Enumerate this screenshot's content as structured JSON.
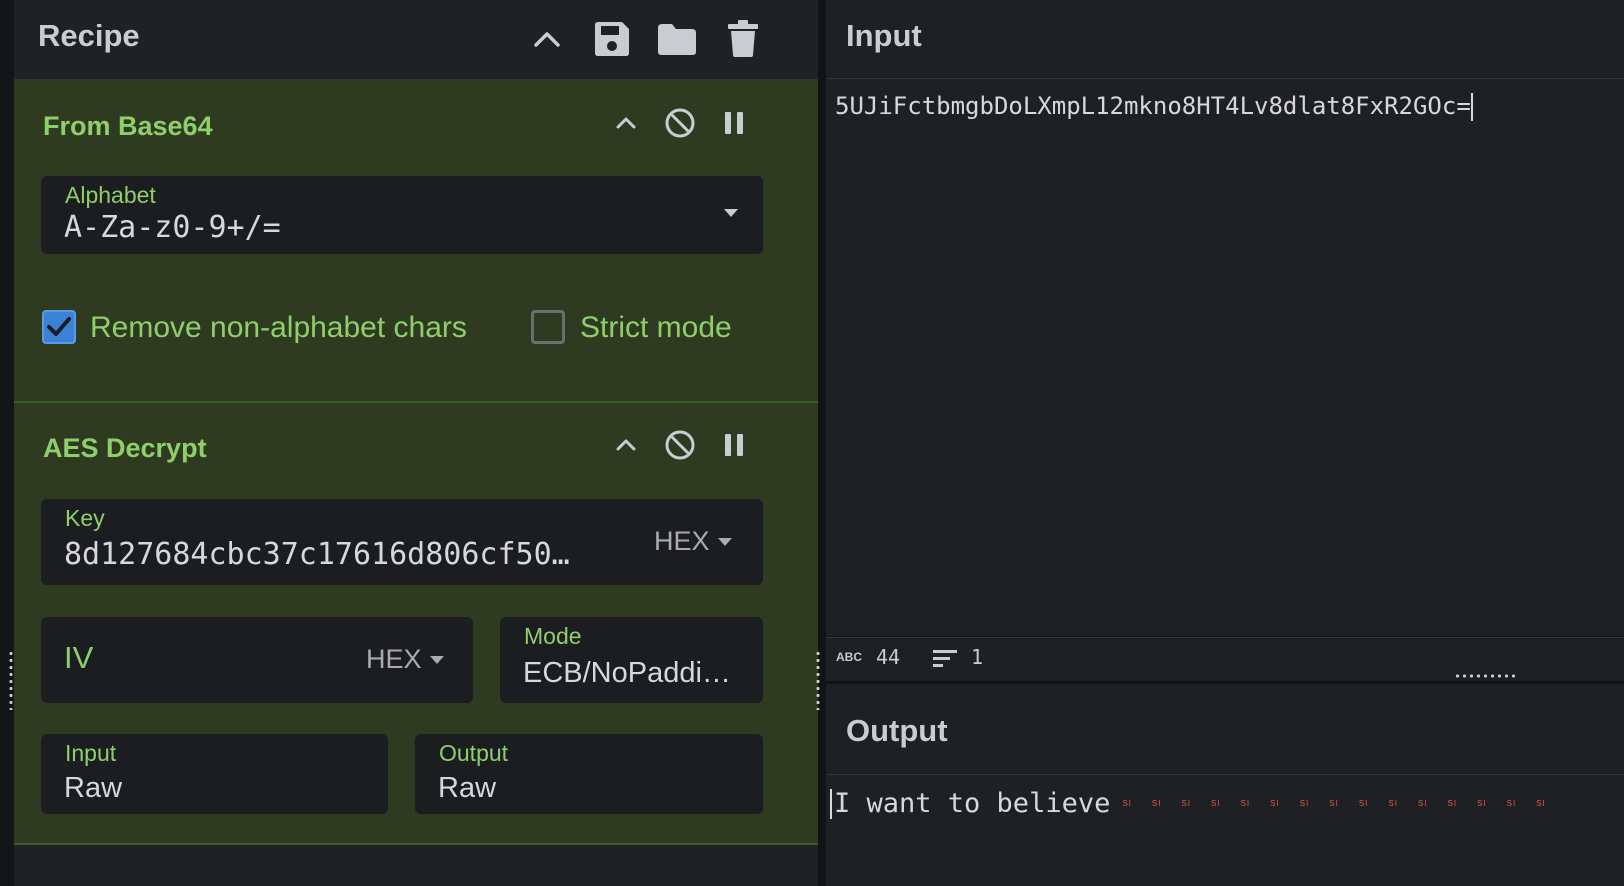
{
  "recipe": {
    "title": "Recipe",
    "header_icons": [
      "chevron-up-icon",
      "save-icon",
      "folder-icon",
      "trash-icon"
    ],
    "operations": [
      {
        "name": "From Base64",
        "alphabet": {
          "label": "Alphabet",
          "value": "A-Za-z0-9+/="
        },
        "remove_non_alphabet": {
          "label": "Remove non-alphabet chars",
          "checked": true
        },
        "strict_mode": {
          "label": "Strict mode",
          "checked": false
        }
      },
      {
        "name": "AES Decrypt",
        "key": {
          "label": "Key",
          "value": "8d127684cbc37c17616d806cf50…",
          "encoding": "HEX"
        },
        "iv": {
          "label": "IV",
          "value": "",
          "encoding": "HEX"
        },
        "mode": {
          "label": "Mode",
          "value": "ECB/NoPaddi…"
        },
        "input": {
          "label": "Input",
          "value": "Raw"
        },
        "output": {
          "label": "Output",
          "value": "Raw"
        }
      }
    ]
  },
  "input": {
    "title": "Input",
    "text": "5UJiFctbmgbDoLXmpL12mkno8HT4Lv8dlat8FxR2GOc=",
    "status": {
      "length_badge": "ABC",
      "length": "44",
      "lines": "1"
    }
  },
  "output": {
    "title": "Output",
    "text": "I want to believe",
    "trailing_marker": "SI"
  },
  "colors": {
    "accent_green": "#8fcf6b",
    "checkbox_blue": "#3b82d6",
    "op_bg": "#2f3b21"
  }
}
